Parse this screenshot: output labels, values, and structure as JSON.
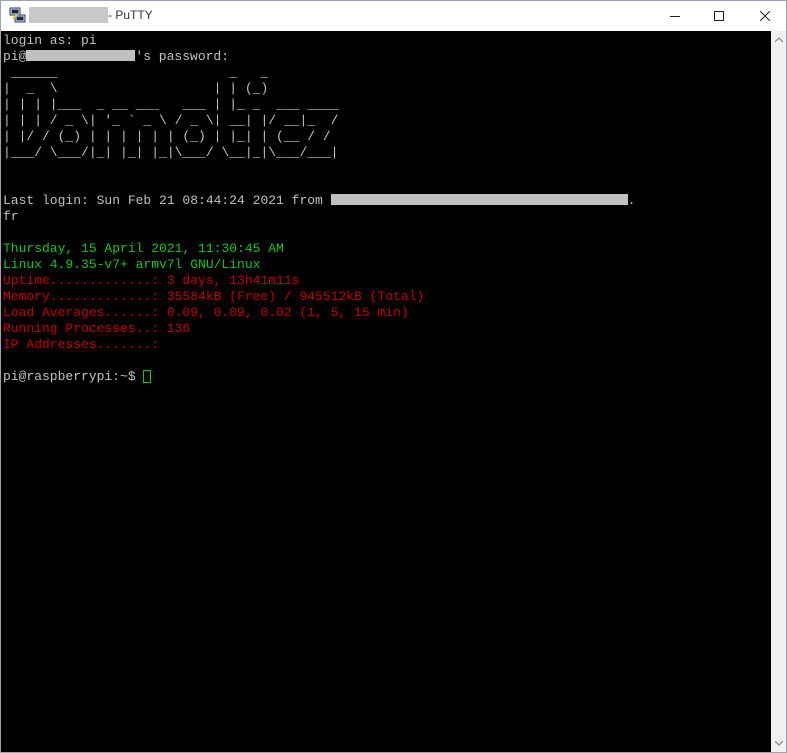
{
  "window": {
    "title": "- PuTTY",
    "controls": {
      "minimize": "minimize-icon",
      "maximize": "maximize-icon",
      "close": "close-icon"
    }
  },
  "terminal": {
    "login": "login as: pi",
    "password_prefix": "pi@",
    "password_suffix": "'s password:",
    "banner": [
      " ______                      _   _",
      "|  _  \\                    | | (_)",
      "| | | |___  _ __ ___   ___ | |_ _  ___ ____",
      "| | | / _ \\| '_ ` _ \\ / _ \\| __| |/ __|_  /",
      "| |/ / (_) | | | | | | (_) | |_| | (__ / /",
      "|___/ \\___/|_| |_| |_|\\___/ \\__|_|\\___/___|"
    ],
    "last_login": "Last login: Sun Feb 21 08:44:24 2021 from ",
    "last_login_end": ".",
    "last_login_wrap": "fr",
    "date_line": "Thursday, 15 April 2021, 11:30:45 AM",
    "kernel_line": "Linux 4.9.35-v7+ armv7l GNU/Linux",
    "uptime": "Uptime.............: 3 days, 13h41m11s",
    "memory": "Memory.............: 35584kB (Free) / 945512kB (Total)",
    "load": "Load Averages......: 0.09, 0.09, 0.02 (1, 5, 15 min)",
    "processes": "Running Processes..: 136",
    "ip": "IP Addresses.......:",
    "prompt": "pi@raspberrypi:~$ "
  },
  "colors": {
    "green": "#19c51d",
    "red": "#c60000",
    "text": "#c0c0c0",
    "background": "#000000"
  }
}
